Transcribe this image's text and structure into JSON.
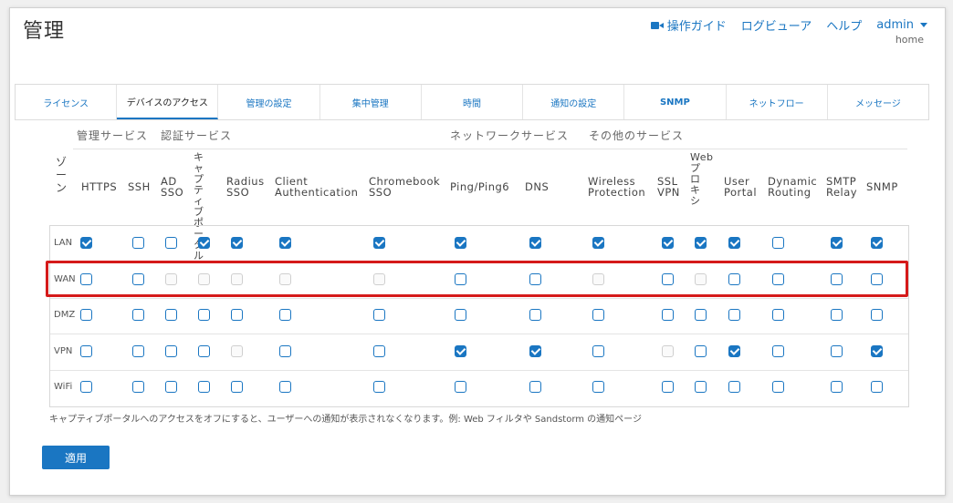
{
  "page_title": "管理",
  "topnav": {
    "guide_label": "操作ガイド",
    "logviewer_label": "ログビューア",
    "help_label": "ヘルプ",
    "user_label": "admin",
    "user_sub": "home"
  },
  "tabs": [
    {
      "label": "ライセンス",
      "active": false
    },
    {
      "label": "デバイスのアクセス",
      "active": true
    },
    {
      "label": "管理の設定",
      "active": false
    },
    {
      "label": "集中管理",
      "active": false
    },
    {
      "label": "時間",
      "active": false
    },
    {
      "label": "通知の設定",
      "active": false
    },
    {
      "label": "SNMP",
      "active": false
    },
    {
      "label": "ネットフロー",
      "active": false
    },
    {
      "label": "メッセージ",
      "active": false
    }
  ],
  "groups": {
    "management": "管理サービス",
    "auth": "認証サービス",
    "network": "ネットワークサービス",
    "other": "その他のサービス"
  },
  "zone_label": "ゾーン",
  "columns": [
    {
      "label": "HTTPS"
    },
    {
      "label": "SSH"
    },
    {
      "label": "AD\nSSO"
    },
    {
      "label": "キャプティブポータル"
    },
    {
      "label": "Radius\nSSO"
    },
    {
      "label": "Client\nAuthentication"
    },
    {
      "label": "Chromebook\nSSO"
    },
    {
      "label": "Ping/Ping6"
    },
    {
      "label": "DNS"
    },
    {
      "label": "Wireless\nProtection"
    },
    {
      "label": "SSL\nVPN"
    },
    {
      "label": "Webプロキシ"
    },
    {
      "label": "User\nPortal"
    },
    {
      "label": "Dynamic\nRouting"
    },
    {
      "label": "SMTP\nRelay"
    },
    {
      "label": "SNMP"
    }
  ],
  "rows": [
    {
      "zone": "LAN",
      "cells": [
        "c",
        "u",
        "u",
        "c",
        "c",
        "c",
        "c",
        "c",
        "c",
        "c",
        "c",
        "c",
        "c",
        "u",
        "c",
        "c"
      ]
    },
    {
      "zone": "WAN",
      "cells": [
        "u",
        "u",
        "d",
        "d",
        "d",
        "d",
        "d",
        "u",
        "u",
        "d",
        "u",
        "d",
        "u",
        "u",
        "u",
        "u"
      ]
    },
    {
      "zone": "DMZ",
      "cells": [
        "u",
        "u",
        "u",
        "u",
        "u",
        "u",
        "u",
        "u",
        "u",
        "u",
        "u",
        "u",
        "u",
        "u",
        "u",
        "u"
      ]
    },
    {
      "zone": "VPN",
      "cells": [
        "u",
        "u",
        "u",
        "u",
        "d",
        "u",
        "u",
        "c",
        "c",
        "u",
        "d",
        "u",
        "c",
        "u",
        "u",
        "c"
      ]
    },
    {
      "zone": "WiFi",
      "cells": [
        "u",
        "u",
        "u",
        "u",
        "u",
        "u",
        "u",
        "u",
        "u",
        "u",
        "u",
        "u",
        "u",
        "u",
        "u",
        "u"
      ]
    }
  ],
  "note": "キャプティブポータルへのアクセスをオフにすると、ユーザーへの通知が表示されなくなります。例: Web フィルタや Sandstorm の通知ページ",
  "apply_label": "適用",
  "colors": {
    "accent": "#1a76c2",
    "highlight": "#d51a1a"
  }
}
